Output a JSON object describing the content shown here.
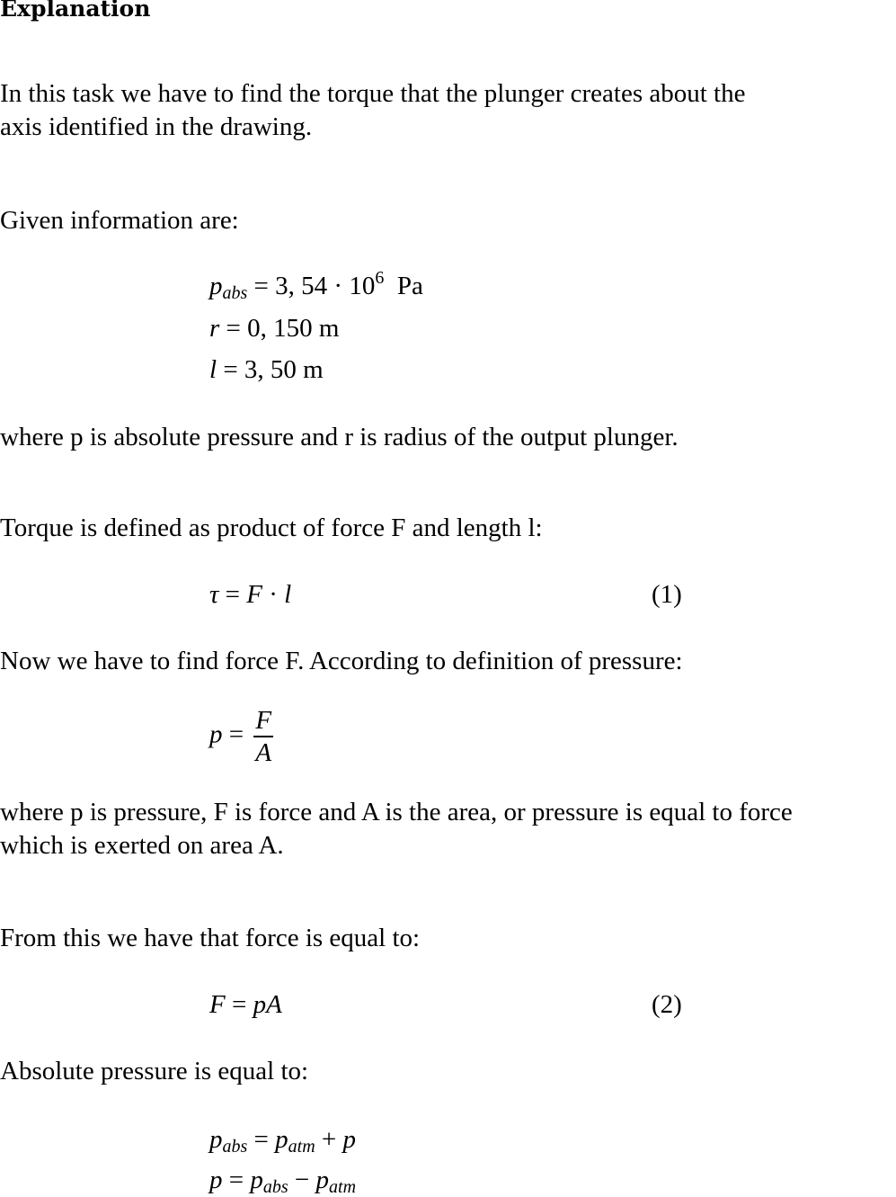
{
  "heading": "Explanation",
  "paragraphs": {
    "intro_line1": "In this task we have to find the torque that the plunger creates about the",
    "intro_line2": "axis identified in the drawing.",
    "given": "Given information are:",
    "where_p_r": "where p is absolute pressure and r is radius of the output plunger.",
    "torque_def": "Torque is defined as product of force F and length l:",
    "find_force": "Now we have to find force F. According to definition of pressure:",
    "where_line1": "where p is pressure, F is force and A is the area, or pressure is equal to force",
    "where_line2": "which is exerted on area A.",
    "from_this": "From this we have that force is equal to:",
    "absolute": "Absolute pressure is equal to:"
  },
  "given_values": {
    "p_abs": {
      "symbol": "p",
      "subscript": "abs",
      "mantissa": "3, 54",
      "base": "10",
      "exponent": "6",
      "unit": "Pa"
    },
    "r": {
      "symbol": "r",
      "value": "0, 150",
      "unit": "m"
    },
    "l": {
      "symbol": "l",
      "value": "3, 50",
      "unit": "m"
    }
  },
  "equations": {
    "eq1": {
      "lhs": "τ",
      "rhs_a": "F",
      "rhs_b": "l",
      "number": "(1)"
    },
    "pressure_def": {
      "lhs": "p",
      "numerator": "F",
      "denominator": "A"
    },
    "eq2": {
      "lhs": "F",
      "rhs": "pA",
      "number": "(2)"
    },
    "abs_sum": {
      "lhs_sym": "p",
      "lhs_sub": "abs",
      "rhs_sym": "p",
      "rhs_sub": "atm",
      "plus_term": "p"
    },
    "p_diff": {
      "lhs": "p",
      "a_sym": "p",
      "a_sub": "abs",
      "b_sym": "p",
      "b_sub": "atm"
    }
  }
}
